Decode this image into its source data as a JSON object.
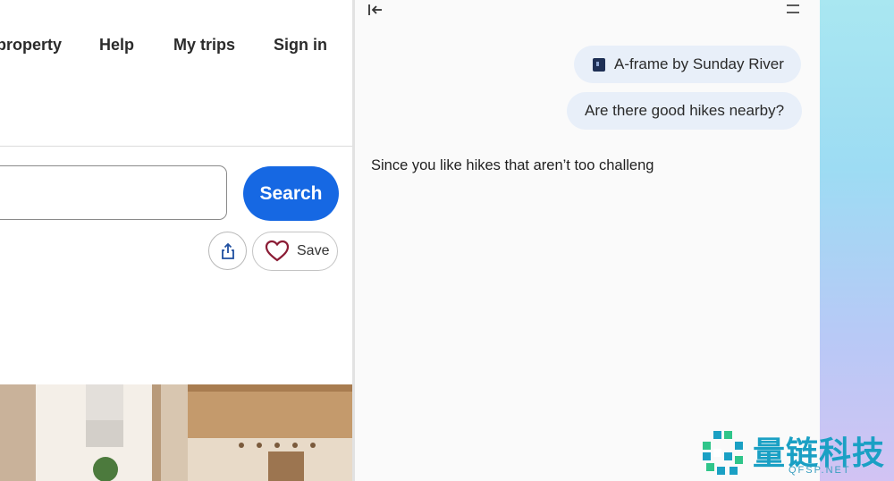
{
  "nav": {
    "property_label": "property",
    "help_label": "Help",
    "trips_label": "My trips",
    "signin_label": "Sign in"
  },
  "search": {
    "button_label": "Search"
  },
  "actions": {
    "save_label": "Save",
    "share_icon": "share-icon",
    "heart_icon": "heart-icon"
  },
  "assistant": {
    "collapse_icon": "collapse-panel-icon",
    "menu_icon": "menu-icon",
    "messages": [
      {
        "type": "context",
        "text": "A-frame by Sunday River"
      },
      {
        "type": "user",
        "text": "Are there good hikes nearby?"
      }
    ],
    "response": "Since you like hikes that aren’t too challeng"
  },
  "watermark": {
    "chinese": "量链科技",
    "english": "QFSP.NET"
  },
  "colors": {
    "primary": "#1668e3",
    "chip_bg": "#e8eff9",
    "heart": "#8b1c35",
    "watermark": "#1aa0c4"
  }
}
